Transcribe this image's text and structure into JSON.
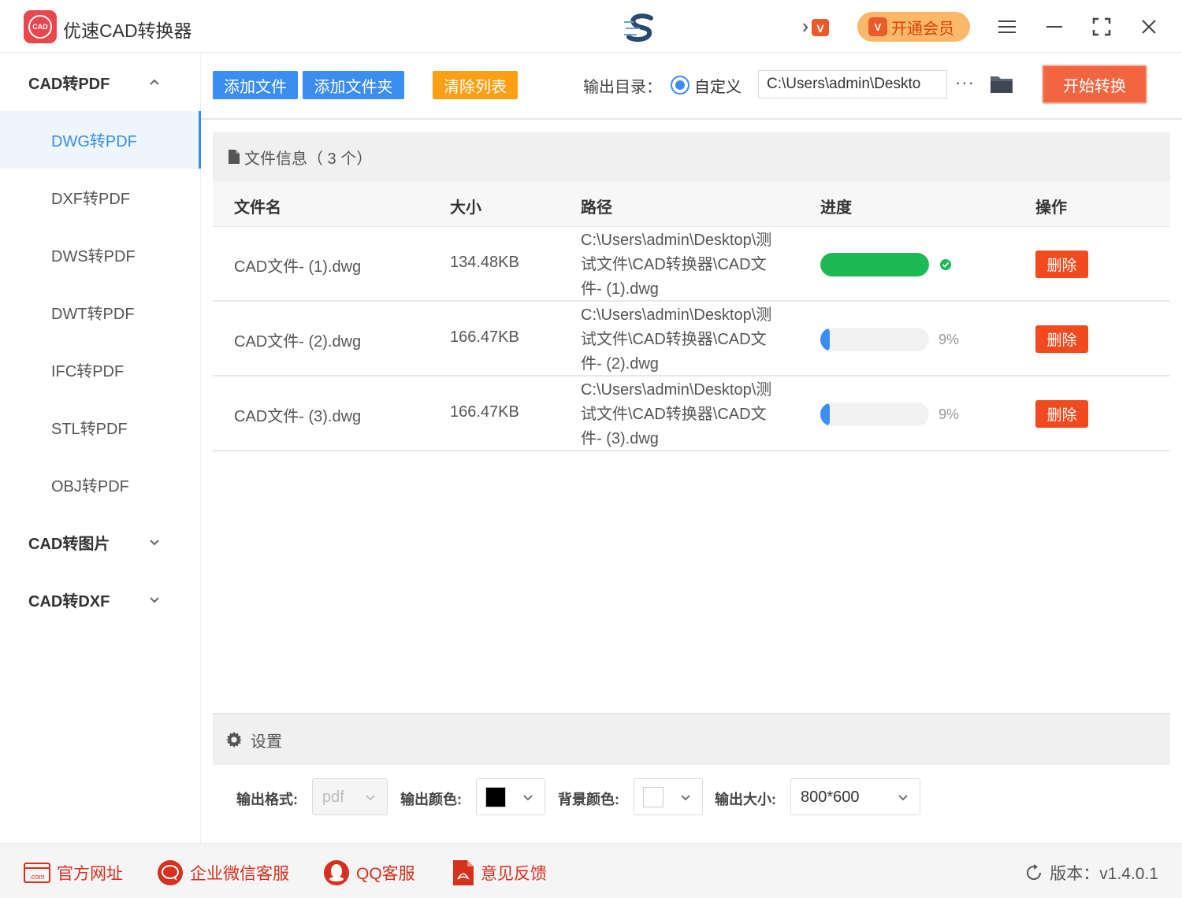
{
  "app": {
    "title": "优速CAD转换器",
    "logo_text": "CAD",
    "vip_badge": "V",
    "vip_label": "开通会员"
  },
  "sidebar": {
    "groups": [
      {
        "label": "CAD转PDF",
        "expanded": true
      },
      {
        "label": "CAD转图片",
        "expanded": false
      },
      {
        "label": "CAD转DXF",
        "expanded": false
      }
    ],
    "items": [
      {
        "label": "DWG转PDF",
        "active": true
      },
      {
        "label": "DXF转PDF"
      },
      {
        "label": "DWS转PDF"
      },
      {
        "label": "DWT转PDF"
      },
      {
        "label": "IFC转PDF"
      },
      {
        "label": "STL转PDF"
      },
      {
        "label": "OBJ转PDF"
      }
    ]
  },
  "toolbar": {
    "add_file": "添加文件",
    "add_folder": "添加文件夹",
    "clear_list": "清除列表",
    "output_dir_label": "输出目录：",
    "custom_label": "自定义",
    "output_path": "C:\\Users\\admin\\Deskto",
    "more": "···",
    "start": "开始转换"
  },
  "file_info": {
    "title": "文件信息（ 3 个）",
    "columns": [
      "文件名",
      "大小",
      "路径",
      "进度",
      "操作"
    ],
    "rows": [
      {
        "name": "CAD文件- (1).dwg",
        "size": "134.48KB",
        "path": "C:\\Users\\admin\\Desktop\\测试文件\\CAD转换器\\CAD文件- (1).dwg",
        "progress": 100,
        "progress_text": "",
        "done": true,
        "action": "删除"
      },
      {
        "name": "CAD文件- (2).dwg",
        "size": "166.47KB",
        "path": "C:\\Users\\admin\\Desktop\\测试文件\\CAD转换器\\CAD文件- (2).dwg",
        "progress": 9,
        "progress_text": "9%",
        "done": false,
        "action": "删除"
      },
      {
        "name": "CAD文件- (3).dwg",
        "size": "166.47KB",
        "path": "C:\\Users\\admin\\Desktop\\测试文件\\CAD转换器\\CAD文件- (3).dwg",
        "progress": 9,
        "progress_text": "9%",
        "done": false,
        "action": "删除"
      }
    ]
  },
  "settings": {
    "title": "设置",
    "output_format_label": "输出格式:",
    "output_format_value": "pdf",
    "output_color_label": "输出颜色:",
    "output_color": "#000000",
    "bg_color_label": "背景颜色:",
    "bg_color": "#ffffff",
    "output_size_label": "输出大小:",
    "output_size_value": "800*600"
  },
  "footer": {
    "website": "官方网址",
    "wechat": "企业微信客服",
    "qq": "QQ客服",
    "feedback": "意见反馈",
    "version": "版本：v1.4.0.1"
  },
  "colors": {
    "accent_blue": "#3b8df0",
    "accent_orange": "#fb9f15",
    "start_red": "#f16540",
    "delete_red": "#f04a1e",
    "progress_done": "#1db954",
    "progress_active": "#3b8df0"
  }
}
